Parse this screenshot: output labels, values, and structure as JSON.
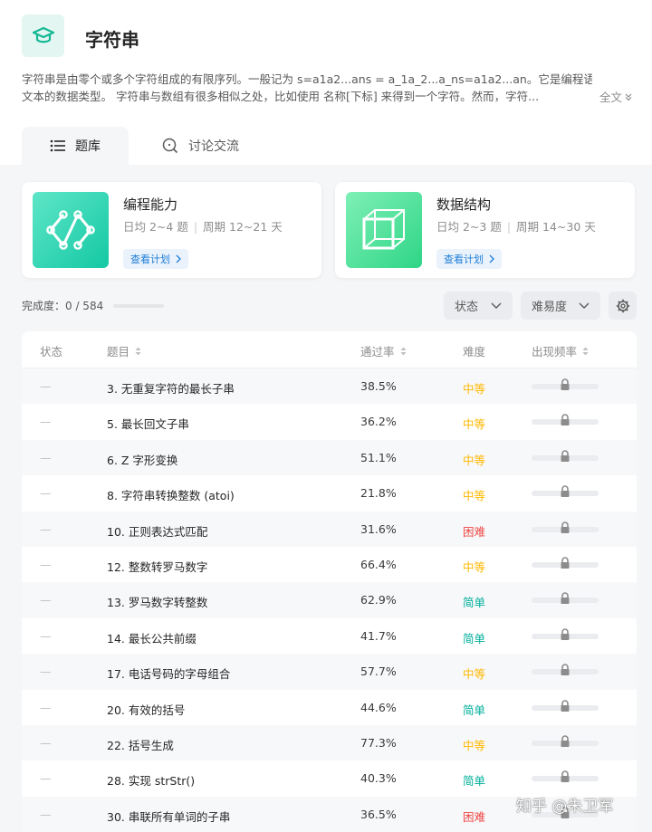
{
  "header": {
    "title": "字符串",
    "description_line1": "字符串是由零个或多个字符组成的有限序列。一般记为 s=a1a2...ans = a_1a_2...a_ns=a1a2...an。它是编程语言中表示",
    "description_line2": "文本的数据类型。 字符串与数组有很多相似之处，比如使用 名称[下标] 来得到一个字符。然而，字符...",
    "expand_label": "全文"
  },
  "tabs": [
    {
      "label": "题库",
      "active": true
    },
    {
      "label": "讨论交流",
      "active": false
    }
  ],
  "plans": [
    {
      "title": "编程能力",
      "daily": "日均 2~4 题",
      "cycle": "周期 12~21 天",
      "button": "查看计划"
    },
    {
      "title": "数据结构",
      "daily": "日均 2~3 题",
      "cycle": "周期 14~30 天",
      "button": "查看计划"
    }
  ],
  "progress": {
    "label": "完成度：0 / 584",
    "done": 0,
    "total": 584
  },
  "filters": {
    "status": "状态",
    "difficulty": "难易度"
  },
  "table": {
    "headers": {
      "status": "状态",
      "title": "题目",
      "rate": "通过率",
      "difficulty": "难度",
      "frequency": "出现频率"
    },
    "rows": [
      {
        "status": "—",
        "title": "3. 无重复字符的最长子串",
        "rate": "38.5%",
        "difficulty": "中等",
        "level": "medium"
      },
      {
        "status": "—",
        "title": "5. 最长回文子串",
        "rate": "36.2%",
        "difficulty": "中等",
        "level": "medium"
      },
      {
        "status": "—",
        "title": "6. Z 字形变换",
        "rate": "51.1%",
        "difficulty": "中等",
        "level": "medium"
      },
      {
        "status": "—",
        "title": "8. 字符串转换整数 (atoi)",
        "rate": "21.8%",
        "difficulty": "中等",
        "level": "medium"
      },
      {
        "status": "—",
        "title": "10. 正则表达式匹配",
        "rate": "31.6%",
        "difficulty": "困难",
        "level": "hard"
      },
      {
        "status": "—",
        "title": "12. 整数转罗马数字",
        "rate": "66.4%",
        "difficulty": "中等",
        "level": "medium"
      },
      {
        "status": "—",
        "title": "13. 罗马数字转整数",
        "rate": "62.9%",
        "difficulty": "简单",
        "level": "easy"
      },
      {
        "status": "—",
        "title": "14. 最长公共前缀",
        "rate": "41.7%",
        "difficulty": "简单",
        "level": "easy"
      },
      {
        "status": "—",
        "title": "17. 电话号码的字母组合",
        "rate": "57.7%",
        "difficulty": "中等",
        "level": "medium"
      },
      {
        "status": "—",
        "title": "20. 有效的括号",
        "rate": "44.6%",
        "difficulty": "简单",
        "level": "easy"
      },
      {
        "status": "—",
        "title": "22. 括号生成",
        "rate": "77.3%",
        "difficulty": "中等",
        "level": "medium"
      },
      {
        "status": "—",
        "title": "28. 实现 strStr()",
        "rate": "40.3%",
        "difficulty": "简单",
        "level": "easy"
      },
      {
        "status": "—",
        "title": "30. 串联所有单词的子串",
        "rate": "36.5%",
        "difficulty": "困难",
        "level": "hard"
      }
    ]
  },
  "watermark": "知乎 @朱卫军",
  "colors": {
    "accent": "#14c8a4",
    "medium": "#ffb800",
    "hard": "#ef4743",
    "easy": "#00af9b",
    "link": "#1d7dd8"
  },
  "icons": {
    "logo": "graduation-cap-icon",
    "library_tab": "list-icon",
    "discuss_tab": "chat-icon",
    "settings": "gear-icon",
    "frequency": "lock-icon"
  }
}
